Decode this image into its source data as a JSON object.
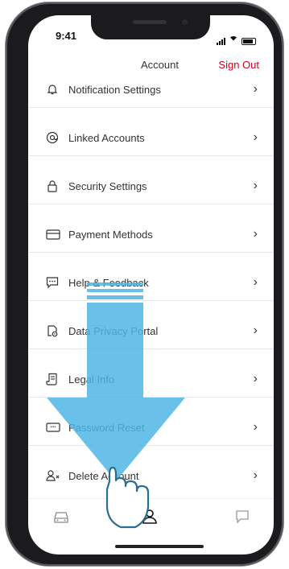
{
  "status": {
    "time": "9:41"
  },
  "header": {
    "title": "Account",
    "sign_out": "Sign Out"
  },
  "menu_items": [
    {
      "label": "Notification Settings",
      "icon": "bell-icon"
    },
    {
      "label": "Linked Accounts",
      "icon": "at-icon"
    },
    {
      "label": "Security Settings",
      "icon": "lock-icon"
    },
    {
      "label": "Payment Methods",
      "icon": "card-icon"
    },
    {
      "label": "Help & Feedback",
      "icon": "chat-icon"
    },
    {
      "label": "Data Privacy Portal",
      "icon": "privacy-icon"
    },
    {
      "label": "Legal Info",
      "icon": "document-icon"
    },
    {
      "label": "Password Reset",
      "icon": "password-icon"
    },
    {
      "label": "Delete Account",
      "icon": "delete-user-icon"
    }
  ],
  "tabs": [
    {
      "icon": "car-icon"
    },
    {
      "icon": "user-icon",
      "active": true
    },
    {
      "icon": "message-icon"
    }
  ],
  "colors": {
    "accent": "#d0021b",
    "overlay_arrow": "#4fb6e6"
  }
}
